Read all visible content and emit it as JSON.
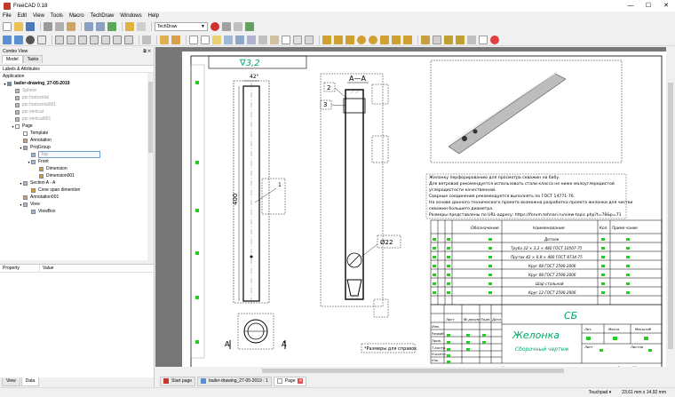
{
  "window": {
    "title": "FreeCAD 0.18",
    "minimize": "—",
    "maximize": "☐",
    "close": "✕"
  },
  "menu": [
    "File",
    "Edit",
    "View",
    "Tools",
    "Macro",
    "TechDraw",
    "Windows",
    "Help"
  ],
  "toolbar": {
    "workbench": "TechDraw"
  },
  "combo_view": {
    "title": "Combo View",
    "tabs": [
      "Model",
      "Tasks"
    ],
    "labels_header": "Labels & Attributes",
    "app_label": "Application",
    "tree": [
      {
        "label": "bailer-drawing_27-05-2019",
        "level": 0,
        "expander": "▾",
        "style": "bold",
        "icon": "doc"
      },
      {
        "label": "Sphere",
        "level": 1,
        "expander": "",
        "style": "dim",
        "icon": "solid"
      },
      {
        "label": "pin horizontal",
        "level": 1,
        "expander": "",
        "style": "dim",
        "icon": "solid"
      },
      {
        "label": "pin horizontal001",
        "level": 1,
        "expander": "",
        "style": "dim",
        "icon": "solid"
      },
      {
        "label": "pin vertical",
        "level": 1,
        "expander": "",
        "style": "dim",
        "icon": "solid"
      },
      {
        "label": "pin vertical001",
        "level": 1,
        "expander": "",
        "style": "dim",
        "icon": "solid"
      },
      {
        "label": "Page",
        "level": 1,
        "expander": "▾",
        "style": "",
        "icon": "page"
      },
      {
        "label": "Template",
        "level": 2,
        "expander": "",
        "style": "",
        "icon": "page"
      },
      {
        "label": "Annotation",
        "level": 2,
        "expander": "",
        "style": "",
        "icon": "text"
      },
      {
        "label": "ProjGroup",
        "level": 2,
        "expander": "▾",
        "style": "",
        "icon": "group"
      },
      {
        "label": "Top",
        "level": 3,
        "expander": "",
        "style": "sel",
        "icon": "view"
      },
      {
        "label": "Front",
        "level": 3,
        "expander": "▾",
        "style": "",
        "icon": "view"
      },
      {
        "label": "Dimension",
        "level": 4,
        "expander": "",
        "style": "",
        "icon": "dim"
      },
      {
        "label": "Dimension001",
        "level": 4,
        "expander": "",
        "style": "",
        "icon": "dim"
      },
      {
        "label": "Section A - A",
        "level": 2,
        "expander": "▾",
        "style": "",
        "icon": "view"
      },
      {
        "label": "Cone span dimention",
        "level": 3,
        "expander": "",
        "style": "",
        "icon": "dim"
      },
      {
        "label": "Annotation001",
        "level": 2,
        "expander": "",
        "style": "",
        "icon": "text"
      },
      {
        "label": "View",
        "level": 2,
        "expander": "▾",
        "style": "",
        "icon": "view"
      },
      {
        "label": "ViewBox",
        "level": 3,
        "expander": "",
        "style": "",
        "icon": "view"
      }
    ],
    "property_col": "Property",
    "value_col": "Value",
    "bottom_tabs": [
      "View",
      "Data"
    ]
  },
  "drawing": {
    "roughness": "∇3,2",
    "angle_label": "42°",
    "length_label": "400",
    "dia_label": "Ø22",
    "section_label": "A—A",
    "callouts": [
      "1",
      "2",
      "3"
    ],
    "cut_letter": "A",
    "notes": [
      "Желонку перфорированию для просмотра скважин на бабу.",
      "Для ветровой рекомендуется использовать стали класса не ниже малоуглеродистой",
      "углеродистости качественной.",
      "Сварные соединения рекомендуется выполнять по ГОСТ 14771-76.",
      "На основе данного технического проекта возможна разработка проекта желонки для чистки",
      "скважин большего диаметра.",
      "Размеры представлены по URL-адресу: https://forum.tehnari.ru/view-topic.php?t=78&p=71"
    ],
    "dims_note": "*Размеры для справок",
    "bom_headers": [
      "Обозначение",
      "Наименование",
      "Кол.",
      "Приме-чание"
    ],
    "bom_rows": [
      "Детали",
      "Труба 32 × 3,2 × 480 ГОСТ 10507-75",
      "Пруток 42 × 0,8 × 480 ГОСТ 8734-75",
      "Круг 08 ГОСТ 2590-2006",
      "Круг 08 ГОСТ 2590-2006",
      "Шар стальной",
      "Круг 12 ГОСТ 2590-2006"
    ],
    "stamp_code": "СБ",
    "stamp_title": "Желонка",
    "stamp_subtitle": "Сборочный чертеж",
    "stamp_rows": [
      "Изм.",
      "Разраб.",
      "Пров.",
      "Т.контр.",
      "Н.контр.",
      "Утв."
    ],
    "stamp_cols": [
      "Лист",
      "№ докум.",
      "Подп.",
      "Дата"
    ],
    "stamp_meta": [
      "Лит.",
      "Масса",
      "Масштаб"
    ],
    "sheet_label": "Лист",
    "sheets_label": "Листов",
    "copied": "Копировал",
    "format": "Формат А3"
  },
  "doc_tabs": [
    {
      "label": "Start page",
      "active": false
    },
    {
      "label": "bailer-drawing_27-05-2019 : 1",
      "active": false
    },
    {
      "label": "Page",
      "active": true
    }
  ],
  "status": {
    "nav": "Touchpad",
    "dims": "23,61 mm x 14,92 mm"
  }
}
